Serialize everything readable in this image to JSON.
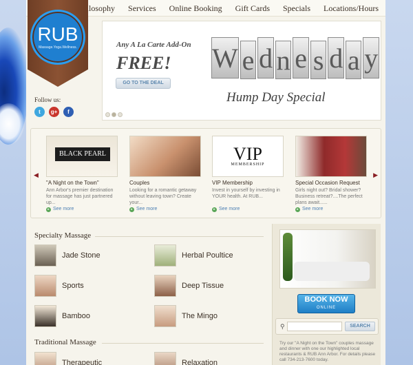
{
  "nav": {
    "items": [
      "Philosophy",
      "Services",
      "Online Booking",
      "Gift Cards",
      "Specials",
      "Locations/Hours"
    ]
  },
  "logo": {
    "text": "RUB",
    "tagline": "Massage.Yoga.Wellness."
  },
  "follow": {
    "label": "Follow us:",
    "icons": [
      "twitter-icon",
      "google-plus-icon",
      "facebook-icon"
    ]
  },
  "banner": {
    "promo_line": "Any A La Carte Add-On",
    "promo_big": "FREE!",
    "deal_button": "GO TO THE DEAL",
    "tile_letters": [
      "W",
      "e",
      "d",
      "n",
      "e",
      "s",
      "d",
      "a",
      "y"
    ],
    "subtitle": "Hump Day Special"
  },
  "carousel": {
    "items": [
      {
        "title": "\"A Night on the Town\"",
        "desc": "Ann Arbor's premier destination for massage has just partnered up...",
        "more": "See more",
        "thumb_text": "BLACK PEARL"
      },
      {
        "title": "Couples",
        "desc": "Looking for a romantic getaway without leaving town? Create your...",
        "more": "See more"
      },
      {
        "title": "VIP Membership",
        "desc": "Invest in yourself by investing in YOUR health. At RUB...",
        "more": "See more",
        "thumb_text": "VIP",
        "thumb_sub": "MEMBERSHIP"
      },
      {
        "title": "Special Occasion Request",
        "desc": "Girls night out? Bridal shower? Business retreat?....The perfect plans await......",
        "more": "See more"
      }
    ]
  },
  "specialty": {
    "heading": "Specialty Massage",
    "items": [
      "Jade Stone",
      "Herbal Poultice",
      "Sports",
      "Deep Tissue",
      "Bamboo",
      "The Mingo"
    ]
  },
  "traditional": {
    "heading": "Traditional Massage",
    "items": [
      "Therapeutic",
      "Relaxation"
    ]
  },
  "sidebar": {
    "book_now": "BOOK NOW",
    "book_now_sub": "ONLINE",
    "search_button": "SEARCH",
    "promo_text": "Try our \"A Night on the Town\" couples massage and dinner with one our highlighted local restaurants & RUB Ann Arbor. For details please call 734-213-7600 today."
  }
}
